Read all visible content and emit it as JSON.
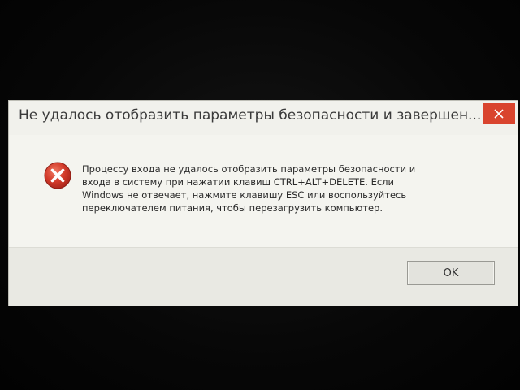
{
  "dialog": {
    "title": "Не удалось отобразить параметры безопасности и завершен...",
    "close_icon": "close-icon",
    "error_icon": "error-icon",
    "message_lines": [
      "Процессу входа не удалось отобразить параметры безопасности и",
      "входа в систему при нажатии клавиш CTRL+ALT+DELETE. Если",
      "Windows не отвечает, нажмите клавишу ESC или воспользуйтесь",
      "переключателем питания, чтобы перезагрузить компьютер."
    ],
    "ok_label": "OK"
  },
  "colors": {
    "close_button": "#d9442e",
    "error_icon": "#d23a2a",
    "dialog_background": "#f4f4ef"
  }
}
